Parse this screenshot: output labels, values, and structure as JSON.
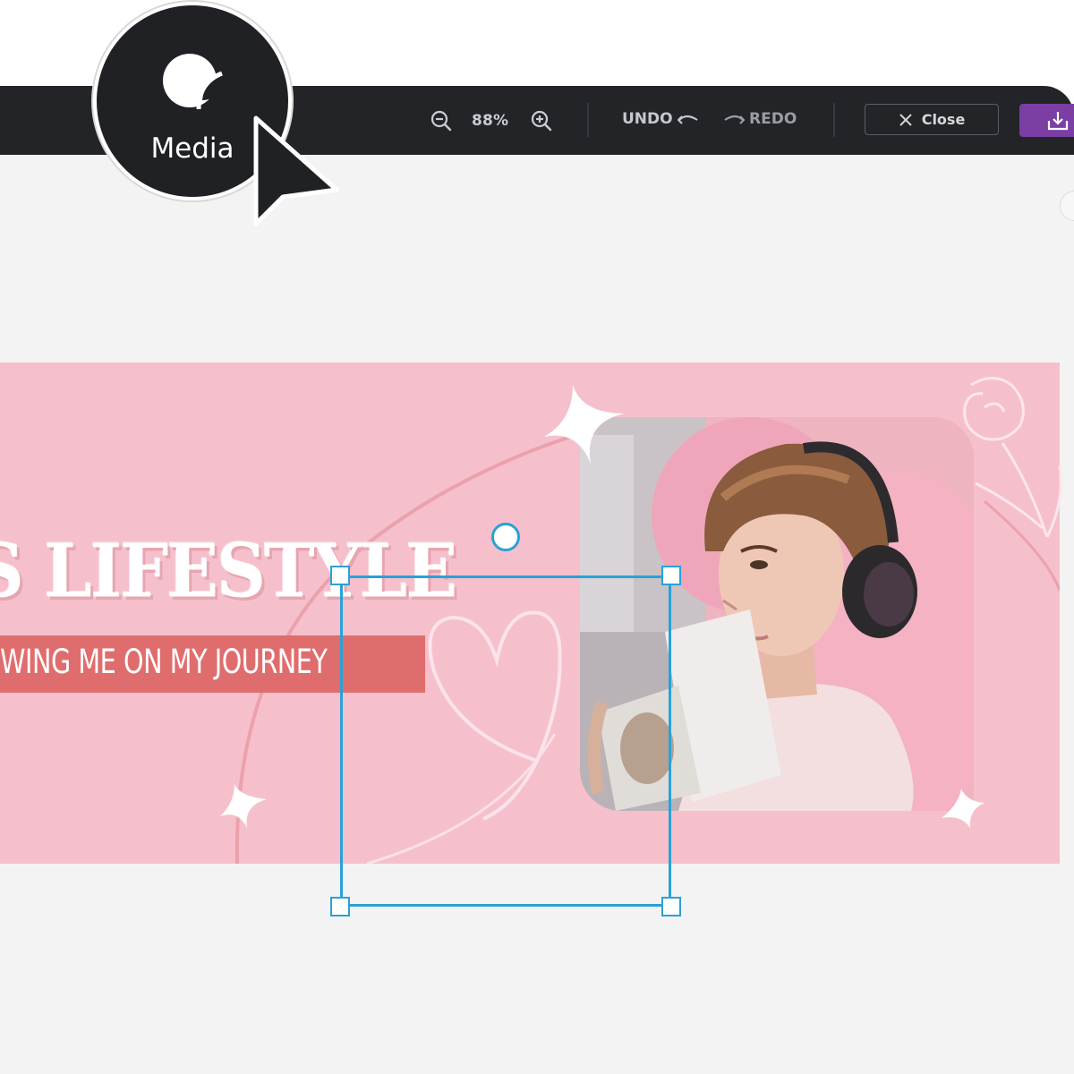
{
  "toolbar": {
    "zoom_level": "88%",
    "undo_label": "UNDO",
    "redo_label": "REDO",
    "close_label": "Close",
    "icons": [
      "zoom-out-icon",
      "zoom-in-icon",
      "undo-icon",
      "redo-icon",
      "close-icon",
      "download-icon"
    ]
  },
  "media_badge": {
    "label": "Media",
    "icon": "sticker-icon"
  },
  "canvas": {
    "title": "S LIFESTYLE",
    "tagline": "OWING ME ON MY JOURNEY"
  },
  "colors": {
    "toolbar_bg": "#222428",
    "workspace_bg": "#f3f3f3",
    "banner_bg": "#f5c0cc",
    "tagline_bg": "#e06d6d",
    "selection": "#2aa1d6",
    "download_accent": "#7b3fa4"
  }
}
